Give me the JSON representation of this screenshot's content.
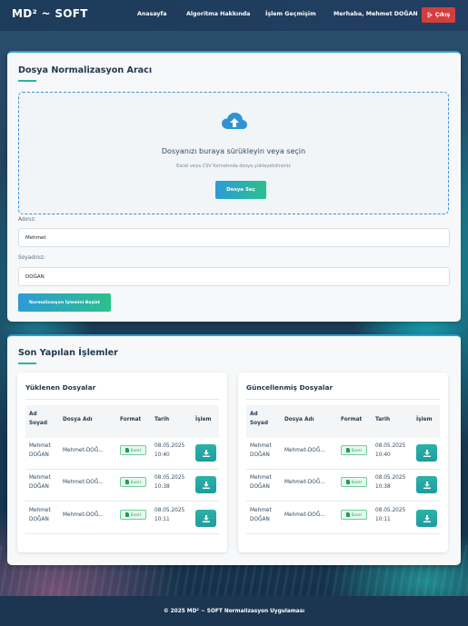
{
  "navbar": {
    "brand": "MD² ~ SOFT",
    "links": [
      "Anasayfa",
      "Algoritma Hakkında",
      "İşlem Geçmişim"
    ],
    "greeting": "Merhaba, Mehmet DOĞAN",
    "logout_label": "Çıkış"
  },
  "upload": {
    "title": "Dosya Normalizasyon Aracı",
    "dropzone_title": "Dosyanızı buraya sürükleyin veya seçin",
    "dropzone_hint": "Excel veya CSV formatında dosya yükleyebilirsiniz",
    "choose_label": "Dosya Seç",
    "first_name_label": "Adınız:",
    "first_name_value": "Mehmet",
    "last_name_label": "Soyadınız:",
    "last_name_value": "DOĞAN",
    "start_label": "Normalizasyon İşlemini Başlat"
  },
  "recent": {
    "title": "Son Yapılan İşlemler",
    "uploaded": {
      "title": "Yüklenen Dosyalar",
      "headers": [
        "Ad Soyad",
        "Dosya Adı",
        "Format",
        "Tarih",
        "İşlem"
      ],
      "rows": [
        {
          "name": "Mehmet DOĞAN",
          "file": "Mehmet-DOĞ...",
          "format": "Excel",
          "date": "08.05.2025",
          "time": "10:40"
        },
        {
          "name": "Mehmet DOĞAN",
          "file": "Mehmet-DOĞ...",
          "format": "Excel",
          "date": "08.05.2025",
          "time": "10:38"
        },
        {
          "name": "Mehmet DOĞAN",
          "file": "Mehmet-DOĞ...",
          "format": "Excel",
          "date": "08.05.2025",
          "time": "10:11"
        }
      ]
    },
    "updated": {
      "title": "Güncellenmiş Dosyalar",
      "headers": [
        "Ad Soyad",
        "Dosya Adı",
        "Format",
        "Tarih",
        "İşlem"
      ],
      "rows": [
        {
          "name": "Mehmet DOĞAN",
          "file": "Mehmet-DOĞ...",
          "format": "Excel",
          "date": "08.05.2025",
          "time": "10:40"
        },
        {
          "name": "Mehmet DOĞAN",
          "file": "Mehmet-DOĞ...",
          "format": "Excel",
          "date": "08.05.2025",
          "time": "10:38"
        },
        {
          "name": "Mehmet DOĞAN",
          "file": "Mehmet-DOĞ...",
          "format": "Excel",
          "date": "08.05.2025",
          "time": "10:11"
        }
      ]
    }
  },
  "footer": {
    "text": "© 2025 MD² ~ SOFT Normalizasyon Uygulaması"
  },
  "colors": {
    "accent_blue": "#2e9bd6",
    "accent_green": "#2bc08d",
    "logout_red": "#d43d3d",
    "excel_green": "#1f9d5a"
  },
  "icons": {
    "logout": "sign-out-icon",
    "upload": "cloud-upload-icon",
    "excel": "file-excel-icon",
    "download": "download-icon"
  }
}
